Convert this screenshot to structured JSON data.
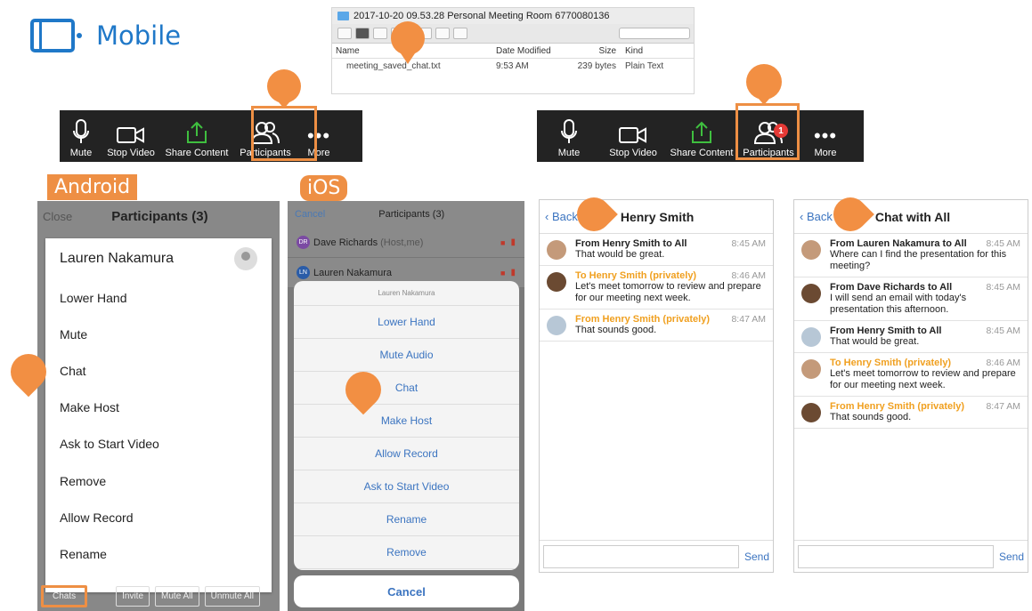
{
  "header": {
    "title": "Mobile"
  },
  "finder": {
    "window_title": "2017-10-20 09.53.28 Personal Meeting Room 6770080136",
    "columns": [
      "Name",
      "Date Modified",
      "Size",
      "Kind"
    ],
    "file": {
      "name": "meeting_saved_chat.txt",
      "modified": "9:53 AM",
      "size": "239 bytes",
      "kind": "Plain Text"
    }
  },
  "toolbar_left": {
    "items": [
      "Mute",
      "Stop Video",
      "Share Content",
      "Participants",
      "More"
    ]
  },
  "toolbar_right": {
    "items": [
      "Mute",
      "Stop Video",
      "Share Content",
      "Participants",
      "More"
    ],
    "participants_badge": "1"
  },
  "labels": {
    "android": "Android",
    "ios": "iOS"
  },
  "android": {
    "close": "Close",
    "title": "Participants (3)",
    "participant_name": "Lauren Nakamura",
    "menu": [
      "Lower Hand",
      "Mute",
      "Chat",
      "Make Host",
      "Ask to Start Video",
      "Remove",
      "Allow Record",
      "Rename"
    ],
    "bottom": [
      "Chats",
      "Invite",
      "Mute All",
      "Unmute All"
    ]
  },
  "ios": {
    "cancel": "Cancel",
    "title": "Participants (3)",
    "rows": [
      {
        "initials": "DR",
        "name": "Dave Richards",
        "note": "(Host,me)"
      },
      {
        "initials": "LN",
        "name": "Lauren Nakamura",
        "note": ""
      }
    ],
    "sheet_title": "Lauren Nakamura",
    "actions": [
      "Lower Hand",
      "Mute Audio",
      "Chat",
      "Make Host",
      "Allow Record",
      "Ask to Start Video",
      "Rename",
      "Remove"
    ],
    "cancel_button": "Cancel"
  },
  "chat_private": {
    "back": "Back",
    "title": "Henry Smith",
    "messages": [
      {
        "from": "From Henry Smith to All",
        "time": "8:45 AM",
        "text": "That would be great.",
        "private": false
      },
      {
        "from": "To Henry Smith (privately)",
        "time": "8:46 AM",
        "text": "Let's meet tomorrow to review and prepare for our meeting next week.",
        "private": true
      },
      {
        "from": "From Henry Smith (privately)",
        "time": "8:47 AM",
        "text": "That sounds good.",
        "private": true
      }
    ],
    "send": "Send"
  },
  "chat_all": {
    "back": "Back",
    "title": "Chat with All",
    "messages": [
      {
        "from": "From Lauren Nakamura to All",
        "time": "8:45 AM",
        "text": "Where can I find the presentation for this meeting?",
        "private": false
      },
      {
        "from": "From Dave Richards to All",
        "time": "8:45 AM",
        "text": "I will send an email with today's presentation this afternoon.",
        "private": false
      },
      {
        "from": "From Henry Smith to All",
        "time": "8:45 AM",
        "text": "That would be great.",
        "private": false
      },
      {
        "from": "To Henry Smith (privately)",
        "time": "8:46 AM",
        "text": "Let's meet tomorrow to review and prepare for our meeting next week.",
        "private": true
      },
      {
        "from": "From Henry Smith (privately)",
        "time": "8:47 AM",
        "text": "That sounds good.",
        "private": true
      }
    ],
    "send": "Send"
  },
  "colors": {
    "accent": "#ee8f44",
    "link": "#3b74c0",
    "private": "#f0a020",
    "toolbar": "#232323",
    "share_green": "#3fbf3f",
    "badge_red": "#e53935"
  }
}
